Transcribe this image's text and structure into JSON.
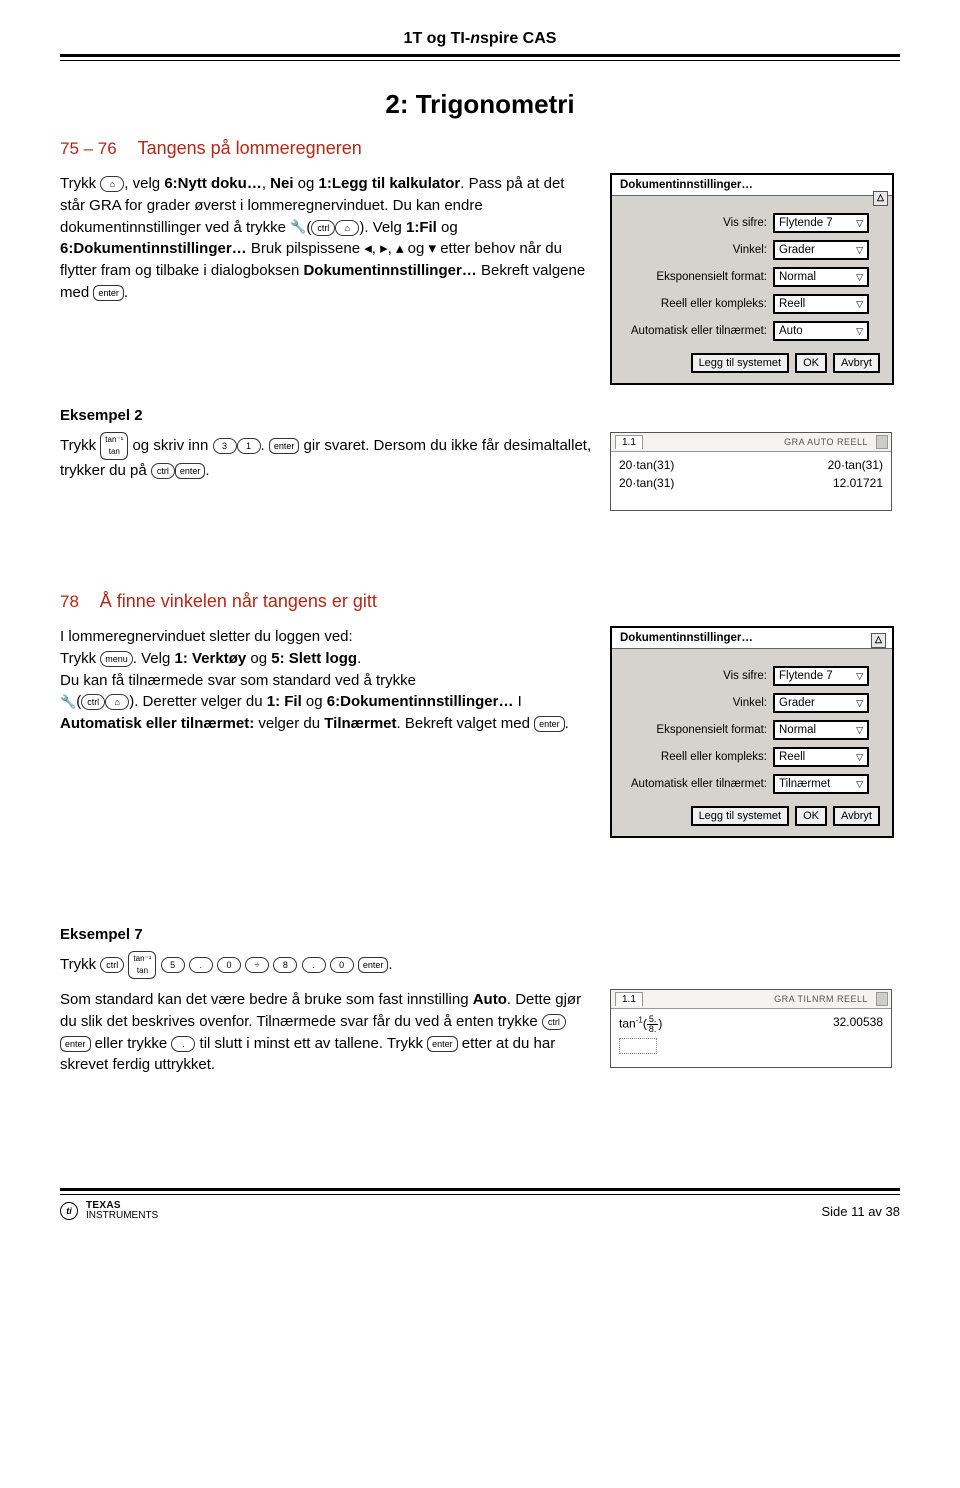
{
  "header": {
    "title_html": "1T og TI-nspire CAS"
  },
  "chapter": {
    "title": "2: Trigonometri"
  },
  "sec1": {
    "pages": "75 – 76",
    "title": "Tangens på lommeregneren",
    "p1a": "Trykk ",
    "p1b": ", velg ",
    "p1c": "6:Nytt doku…",
    "p1d": ", ",
    "p1e": "Nei",
    "p1f": " og ",
    "p1g": "1:Legg til kalkulator",
    "p1h": ". Pass på at det står GRA for grader øverst i lommeregnervinduet. Du kan endre dokumentinnstillinger ved å trykke ",
    "p1i": ". Velg ",
    "p1j": "1:Fil",
    "p1k": " og ",
    "p1l": "6:Dokumentinnstillinger…",
    "p1m": " Bruk pilspissene ◂, ▸, ▴ og ▾ etter behov når du flytter fram og tilbake i dialogboksen ",
    "p1n": "Dokumentinnstillinger…",
    "p1o": " Bekreft valgene med ",
    "p1p": "."
  },
  "dlg1": {
    "title": "Dokumentinnstillinger…",
    "rows": [
      {
        "label": "Vis sifre:",
        "value": "Flytende 7"
      },
      {
        "label": "Vinkel:",
        "value": "Grader"
      },
      {
        "label": "Eksponensielt format:",
        "value": "Normal"
      },
      {
        "label": "Reell eller kompleks:",
        "value": "Reell"
      },
      {
        "label": "Automatisk eller tilnærmet:",
        "value": "Auto"
      }
    ],
    "buttons": [
      "Legg til systemet",
      "OK",
      "Avbryt"
    ]
  },
  "ex2": {
    "label": "Eksempel 2",
    "a": "Trykk ",
    "b": " og skriv inn ",
    "c": ". ",
    "d": " gir svaret. Dersom du ikke får desimaltallet, trykker du på ",
    "e": "."
  },
  "calc1": {
    "tab": "1.1",
    "status": "GRA AUTO REELL",
    "lines": [
      {
        "l": "20·tan(31)",
        "r": "20·tan(31)"
      },
      {
        "l": "20·tan(31)",
        "r": "12.01721"
      }
    ]
  },
  "sec2": {
    "pages": "78",
    "title": "Å finne vinkelen når tangens er gitt",
    "p1": "I lommeregnervinduet sletter du loggen ved:",
    "p2a": "Trykk ",
    "p2b": ". Velg ",
    "p2c": "1: Verktøy",
    "p2d": " og ",
    "p2e": "5: Slett logg",
    "p2f": ".",
    "p3": "Du kan få tilnærmede svar som standard ved å trykke",
    "p4a": ". Deretter velger du ",
    "p4b": "1: Fil",
    "p4c": " og ",
    "p4d": "6:Dokumentinnstillinger…",
    "p4e": " I ",
    "p4f": "Automatisk eller tilnærmet:",
    "p4g": " velger du ",
    "p4h": "Tilnærmet",
    "p4i": ". Bekreft valget med ",
    "p4j": "."
  },
  "dlg2": {
    "title": "Dokumentinnstillinger…",
    "rows": [
      {
        "label": "Vis sifre:",
        "value": "Flytende 7"
      },
      {
        "label": "Vinkel:",
        "value": "Grader"
      },
      {
        "label": "Eksponensielt format:",
        "value": "Normal"
      },
      {
        "label": "Reell eller kompleks:",
        "value": "Reell"
      },
      {
        "label": "Automatisk eller tilnærmet:",
        "value": "Tilnærmet"
      }
    ],
    "buttons": [
      "Legg til systemet",
      "OK",
      "Avbryt"
    ]
  },
  "ex7": {
    "label": "Eksempel 7",
    "a": "Trykk ",
    "b": ".",
    "p2a": "Som standard kan det være bedre å bruke som fast innstilling ",
    "p2b": "Auto",
    "p2c": ". Dette gjør du slik det beskrives ovenfor. Tilnærmede svar får du ved å enten trykke ",
    "p2d": " eller trykke ",
    "p2e": " til slutt i minst ett av tallene. Trykk ",
    "p2f": " etter at du har skrevet ferdig uttrykket."
  },
  "calc2": {
    "tab": "1.1",
    "status": "GRA TILNRM REELL",
    "input": "tan",
    "frac_n": "5.",
    "frac_d": "8.",
    "result": "32.00538"
  },
  "keys": {
    "home": "⌂",
    "ctrl": "ctrl",
    "enter": "enter",
    "tan": "tan",
    "taninv": "tan⁻¹",
    "menu": "menu",
    "k3": "3",
    "k1": "1",
    "k5": "5",
    "k0": "0",
    "k8": "8",
    "dot": ".",
    "div": "÷",
    "approx": "≈"
  },
  "footer": {
    "brand_top": "TEXAS",
    "brand_bot": "INSTRUMENTS",
    "page": "Side 11 av 38"
  },
  "tri": "▽",
  "scroll_up": "△"
}
